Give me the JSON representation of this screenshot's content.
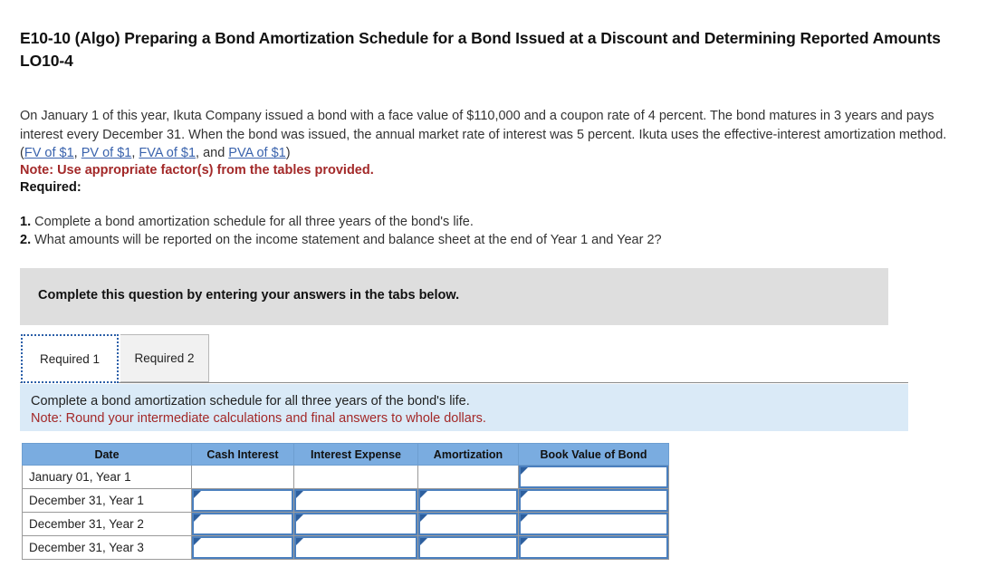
{
  "title": "E10-10 (Algo) Preparing a Bond Amortization Schedule for a Bond Issued at a Discount and Determining Reported Amounts LO10-4",
  "problem": {
    "text_part_1": "On January 1 of this year, Ikuta Company issued a bond with a face value of $110,000 and a coupon rate of 4 percent. The bond matures in 3 years and pays interest every December 31. When the bond was issued, the annual market rate of interest was 5 percent. Ikuta uses the effective-interest amortization method. (",
    "link_1": "FV of $1",
    "sep_1": ", ",
    "link_2": "PV of $1",
    "sep_2": ", ",
    "link_3": "FVA of $1",
    "sep_3": ", and ",
    "link_4": "PVA of $1",
    "text_part_2": ")",
    "note": "Note: Use appropriate factor(s) from the tables provided.",
    "required_label": "Required:"
  },
  "requirements": [
    {
      "num": "1.",
      "text": "Complete a bond amortization schedule for all three years of the bond's life."
    },
    {
      "num": "2.",
      "text": "What amounts will be reported on the income statement and balance sheet at the end of Year 1 and Year 2?"
    }
  ],
  "gray_banner": {
    "text": "Complete this question by entering your answers in the tabs below."
  },
  "tabs": [
    {
      "label": "Required 1",
      "active": true
    },
    {
      "label": "Required 2",
      "active": false
    }
  ],
  "info_panel": {
    "line_1": "Complete a bond amortization schedule for all three years of the bond's life.",
    "line_2": "Note: Round your intermediate calculations and final answers to whole dollars."
  },
  "table": {
    "headers": [
      "Date",
      "Cash Interest",
      "Interest Expense",
      "Amortization",
      "Book Value of Bond"
    ],
    "rows": [
      {
        "date": "January 01, Year 1",
        "cash_interest": "",
        "interest_expense": "",
        "amortization": "",
        "book_value": "",
        "inputs": [
          false,
          false,
          false,
          true
        ]
      },
      {
        "date": "December 31, Year 1",
        "cash_interest": "",
        "interest_expense": "",
        "amortization": "",
        "book_value": "",
        "inputs": [
          true,
          true,
          true,
          true
        ]
      },
      {
        "date": "December 31, Year 2",
        "cash_interest": "",
        "interest_expense": "",
        "amortization": "",
        "book_value": "",
        "inputs": [
          true,
          true,
          true,
          true
        ]
      },
      {
        "date": "December 31, Year 3",
        "cash_interest": "",
        "interest_expense": "",
        "amortization": "",
        "book_value": "",
        "inputs": [
          true,
          true,
          true,
          true
        ]
      }
    ]
  },
  "colors": {
    "header_blue": "#7aace0",
    "info_panel_blue": "#daeaf7",
    "gray_banner": "#dedede",
    "note_red": "#a32929",
    "link_blue": "#3a63ad",
    "input_border": "#4a7fbe"
  }
}
